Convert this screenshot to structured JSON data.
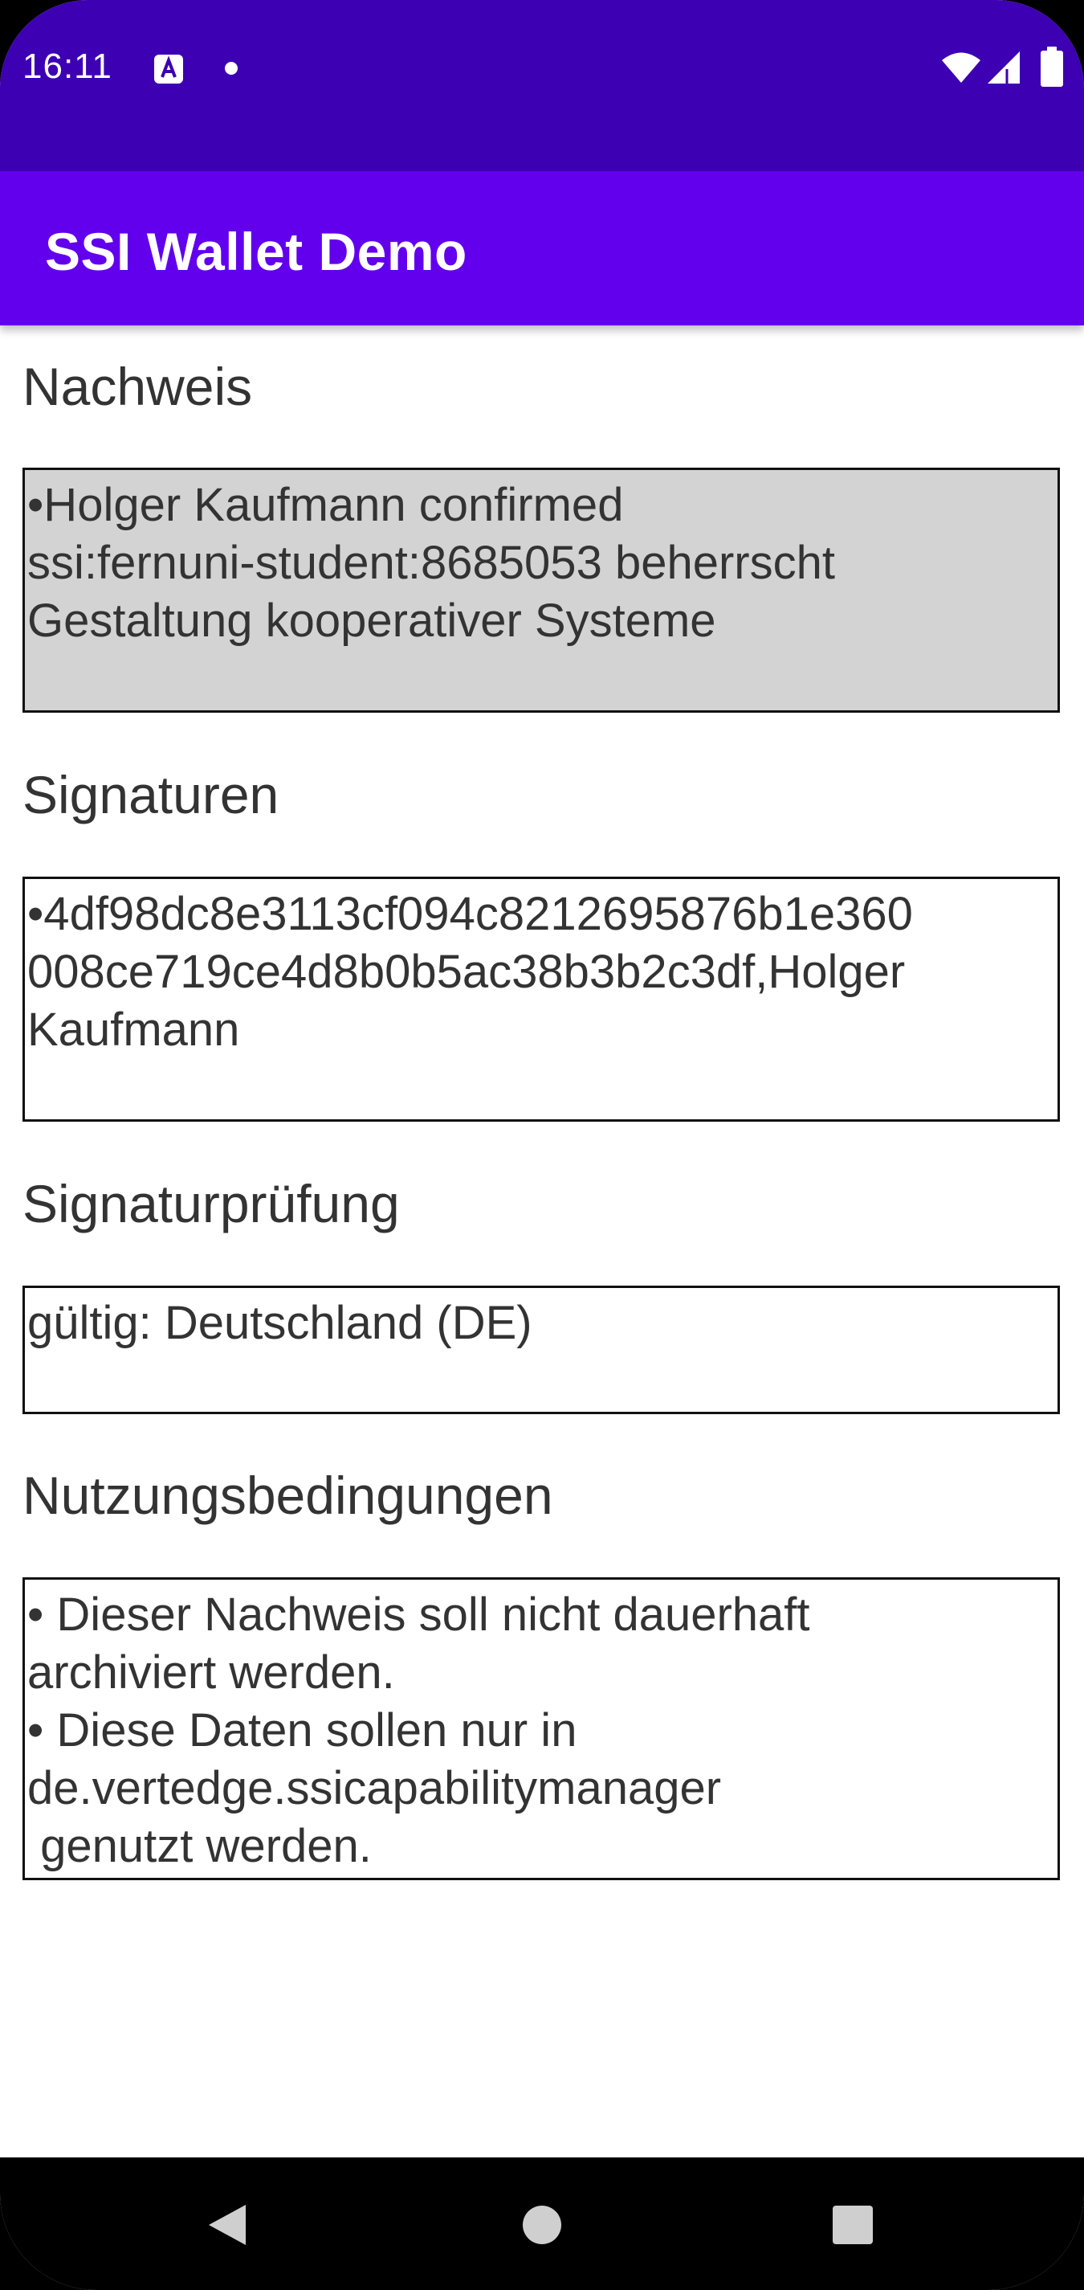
{
  "status_bar": {
    "time": "16:11",
    "icons": [
      "font-a-icon",
      "notification-dot-icon",
      "wifi-icon",
      "cell-signal-icon",
      "battery-icon"
    ],
    "background": "#3d00b3"
  },
  "app_bar": {
    "title": "SSI Wallet Demo",
    "background": "#6200ee"
  },
  "sections": {
    "proof": {
      "label": "Nachweis",
      "text": "•Holger Kaufmann confirmed\nssi:fernuni-student:8685053 beherrscht\nGestaltung kooperativer Systeme"
    },
    "signatures": {
      "label": "Signaturen",
      "text": "•4df98dc8e3113cf094c8212695876b1e360\n008ce719ce4d8b0b5ac38b3b2c3df,Holger\nKaufmann"
    },
    "signature_check": {
      "label": "Signaturprüfung",
      "text": "gültig: Deutschland (DE)"
    },
    "terms": {
      "label": "Nutzungsbedingungen",
      "text": "• Dieser Nachweis soll nicht dauerhaft\narchiviert werden.\n• Diese Daten sollen nur in\nde.vertedge.ssicapabilitymanager\n genutzt werden."
    }
  },
  "nav_bar": {
    "icons": [
      "back-icon",
      "home-icon",
      "recents-icon"
    ]
  }
}
